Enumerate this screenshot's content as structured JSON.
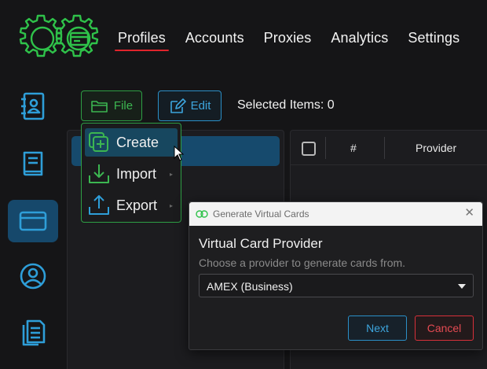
{
  "nav": {
    "items": [
      {
        "label": "Profiles",
        "active": true
      },
      {
        "label": "Accounts"
      },
      {
        "label": "Proxies"
      },
      {
        "label": "Analytics"
      },
      {
        "label": "Settings"
      }
    ],
    "active_underline_color": "#e0242b"
  },
  "logo": {
    "icon": "gear-card-logo-icon",
    "color": "#2fc24a"
  },
  "sidebar": {
    "items": [
      {
        "icon": "address-book-icon"
      },
      {
        "icon": "book-icon"
      },
      {
        "icon": "credit-card-icon",
        "active": true
      },
      {
        "icon": "user-circle-icon"
      },
      {
        "icon": "documents-icon"
      }
    ],
    "accent": "#2e9ed8"
  },
  "toolbar": {
    "file_label": "File",
    "edit_label": "Edit",
    "selected_label": "Selected Items: 0",
    "file_color": "#3cb651",
    "edit_color": "#3da5dd"
  },
  "table": {
    "headers": {
      "num": "#",
      "provider": "Provider"
    }
  },
  "file_menu": {
    "items": [
      {
        "label": "Create",
        "icon": "create-plus-icon",
        "highlighted": true
      },
      {
        "label": "Import",
        "icon": "import-download-icon"
      },
      {
        "label": "Export",
        "icon": "export-upload-icon"
      }
    ]
  },
  "dialog": {
    "window_title": "Generate Virtual Cards",
    "heading": "Virtual Card Provider",
    "subtitle": "Choose a provider to generate cards from.",
    "provider_value": "AMEX (Business)",
    "next_label": "Next",
    "cancel_label": "Cancel"
  }
}
